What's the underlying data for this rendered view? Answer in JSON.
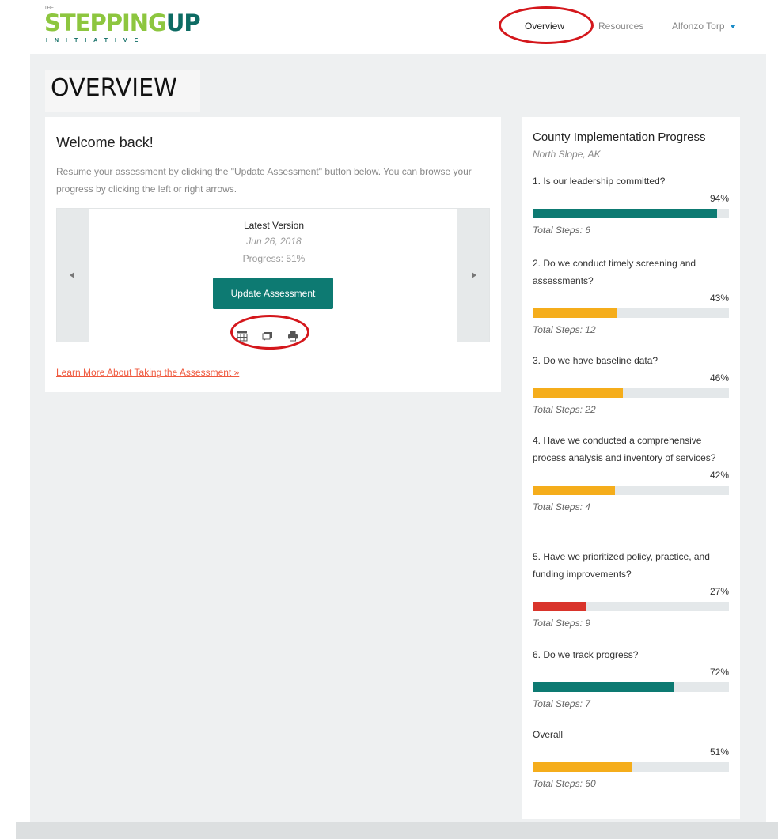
{
  "header": {
    "logo": {
      "top_text": "THE",
      "main_green": "STEPPING",
      "main_teal": "UP",
      "sub_text": "INITIATIVE"
    },
    "nav": {
      "overview": "Overview",
      "resources": "Resources",
      "user": "Alfonzo Torp"
    }
  },
  "colors": {
    "accent": "#0d7a72",
    "teal_bar": "#0d7a72",
    "yellow_bar": "#f5ad1b",
    "red_bar": "#d9342b",
    "link": "#ef5a3f",
    "highlight_ellipse": "#d4171c"
  },
  "page": {
    "title": "OVERVIEW"
  },
  "welcome": {
    "title": "Welcome back!",
    "description": "Resume your assessment by clicking the \"Update Assessment\" button below. You can browse your progress by clicking the left or right arrows.",
    "latest_version_label": "Latest Version",
    "date": "Jun 26, 2018",
    "progress": "Progress: 51%",
    "update_button": "Update Assessment",
    "icons": [
      "table-icon",
      "comments-icon",
      "print-icon"
    ],
    "learn_more": "Learn More About Taking the Assessment »"
  },
  "progress_panel": {
    "title": "County Implementation Progress",
    "location": "North Slope, AK",
    "questions": [
      {
        "text": "1. Is our leadership committed?",
        "percent": "94%",
        "value": 0.94,
        "color": "#0d7a72",
        "steps": "Total Steps: 6"
      },
      {
        "text": "2. Do we conduct timely screening and assessments?",
        "percent": "43%",
        "value": 0.43,
        "color": "#f5ad1b",
        "steps": "Total Steps: 12"
      },
      {
        "text": "3. Do we have baseline data?",
        "percent": "46%",
        "value": 0.46,
        "color": "#f5ad1b",
        "steps": "Total Steps: 22"
      },
      {
        "text": "4. Have we conducted a comprehensive process analysis and inventory of services?",
        "percent": "42%",
        "value": 0.42,
        "color": "#f5ad1b",
        "steps": "Total Steps: 4"
      },
      {
        "text": "5. Have we prioritized policy, practice, and funding improvements?",
        "percent": "27%",
        "value": 0.27,
        "color": "#d9342b",
        "steps": "Total Steps: 9"
      },
      {
        "text": "6. Do we track progress?",
        "percent": "72%",
        "value": 0.72,
        "color": "#0d7a72",
        "steps": "Total Steps: 7"
      },
      {
        "text": "Overall",
        "percent": "51%",
        "value": 0.51,
        "color": "#f5ad1b",
        "steps": "Total Steps: 60"
      }
    ]
  }
}
